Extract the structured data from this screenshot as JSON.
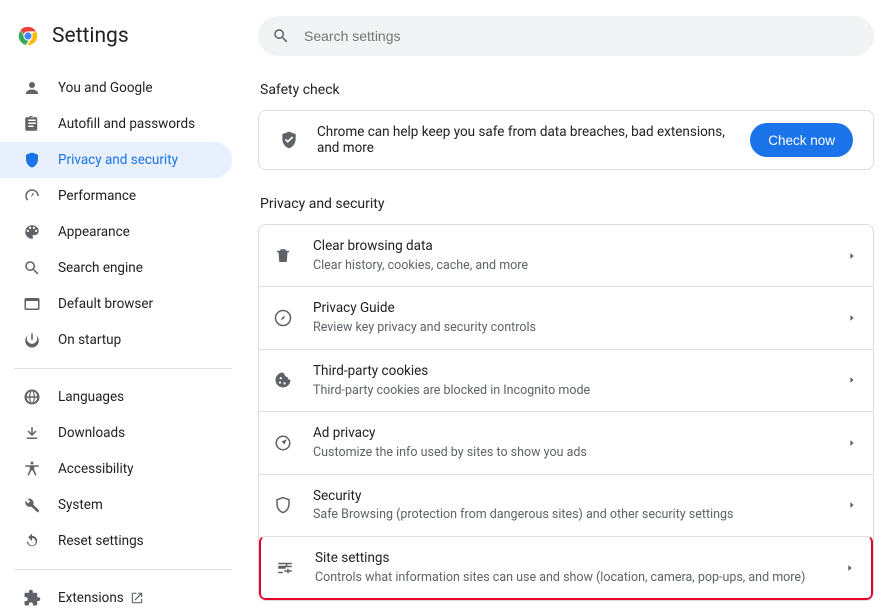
{
  "brand": {
    "title": "Settings"
  },
  "search": {
    "placeholder": "Search settings"
  },
  "sidebar": {
    "items": [
      {
        "label": "You and Google"
      },
      {
        "label": "Autofill and passwords"
      },
      {
        "label": "Privacy and security"
      },
      {
        "label": "Performance"
      },
      {
        "label": "Appearance"
      },
      {
        "label": "Search engine"
      },
      {
        "label": "Default browser"
      },
      {
        "label": "On startup"
      }
    ],
    "more": [
      {
        "label": "Languages"
      },
      {
        "label": "Downloads"
      },
      {
        "label": "Accessibility"
      },
      {
        "label": "System"
      },
      {
        "label": "Reset settings"
      }
    ],
    "extensions": {
      "label": "Extensions"
    }
  },
  "safety": {
    "title": "Safety check",
    "text": "Chrome can help keep you safe from data breaches, bad extensions, and more",
    "button": "Check now"
  },
  "privacy": {
    "title": "Privacy and security",
    "rows": [
      {
        "title": "Clear browsing data",
        "sub": "Clear history, cookies, cache, and more"
      },
      {
        "title": "Privacy Guide",
        "sub": "Review key privacy and security controls"
      },
      {
        "title": "Third-party cookies",
        "sub": "Third-party cookies are blocked in Incognito mode"
      },
      {
        "title": "Ad privacy",
        "sub": "Customize the info used by sites to show you ads"
      },
      {
        "title": "Security",
        "sub": "Safe Browsing (protection from dangerous sites) and other security settings"
      },
      {
        "title": "Site settings",
        "sub": "Controls what information sites can use and show (location, camera, pop-ups, and more)"
      }
    ]
  }
}
